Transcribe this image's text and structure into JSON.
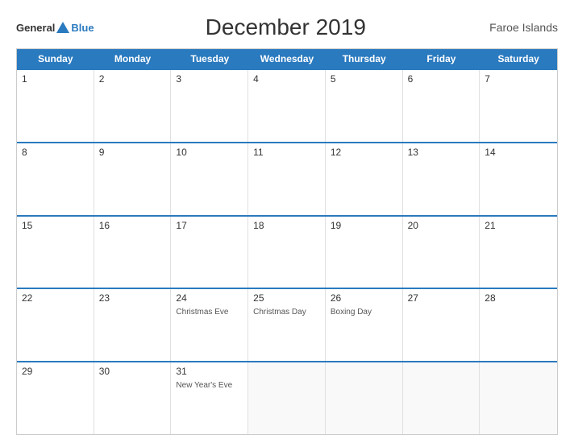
{
  "header": {
    "title": "December 2019",
    "region": "Faroe Islands",
    "logo": {
      "general": "General",
      "blue": "Blue"
    }
  },
  "days": [
    "Sunday",
    "Monday",
    "Tuesday",
    "Wednesday",
    "Thursday",
    "Friday",
    "Saturday"
  ],
  "weeks": [
    [
      {
        "num": "1",
        "event": ""
      },
      {
        "num": "2",
        "event": ""
      },
      {
        "num": "3",
        "event": ""
      },
      {
        "num": "4",
        "event": ""
      },
      {
        "num": "5",
        "event": ""
      },
      {
        "num": "6",
        "event": ""
      },
      {
        "num": "7",
        "event": ""
      }
    ],
    [
      {
        "num": "8",
        "event": ""
      },
      {
        "num": "9",
        "event": ""
      },
      {
        "num": "10",
        "event": ""
      },
      {
        "num": "11",
        "event": ""
      },
      {
        "num": "12",
        "event": ""
      },
      {
        "num": "13",
        "event": ""
      },
      {
        "num": "14",
        "event": ""
      }
    ],
    [
      {
        "num": "15",
        "event": ""
      },
      {
        "num": "16",
        "event": ""
      },
      {
        "num": "17",
        "event": ""
      },
      {
        "num": "18",
        "event": ""
      },
      {
        "num": "19",
        "event": ""
      },
      {
        "num": "20",
        "event": ""
      },
      {
        "num": "21",
        "event": ""
      }
    ],
    [
      {
        "num": "22",
        "event": ""
      },
      {
        "num": "23",
        "event": ""
      },
      {
        "num": "24",
        "event": "Christmas Eve"
      },
      {
        "num": "25",
        "event": "Christmas Day"
      },
      {
        "num": "26",
        "event": "Boxing Day"
      },
      {
        "num": "27",
        "event": ""
      },
      {
        "num": "28",
        "event": ""
      }
    ],
    [
      {
        "num": "29",
        "event": ""
      },
      {
        "num": "30",
        "event": ""
      },
      {
        "num": "31",
        "event": "New Year's Eve"
      },
      {
        "num": "",
        "event": ""
      },
      {
        "num": "",
        "event": ""
      },
      {
        "num": "",
        "event": ""
      },
      {
        "num": "",
        "event": ""
      }
    ]
  ]
}
